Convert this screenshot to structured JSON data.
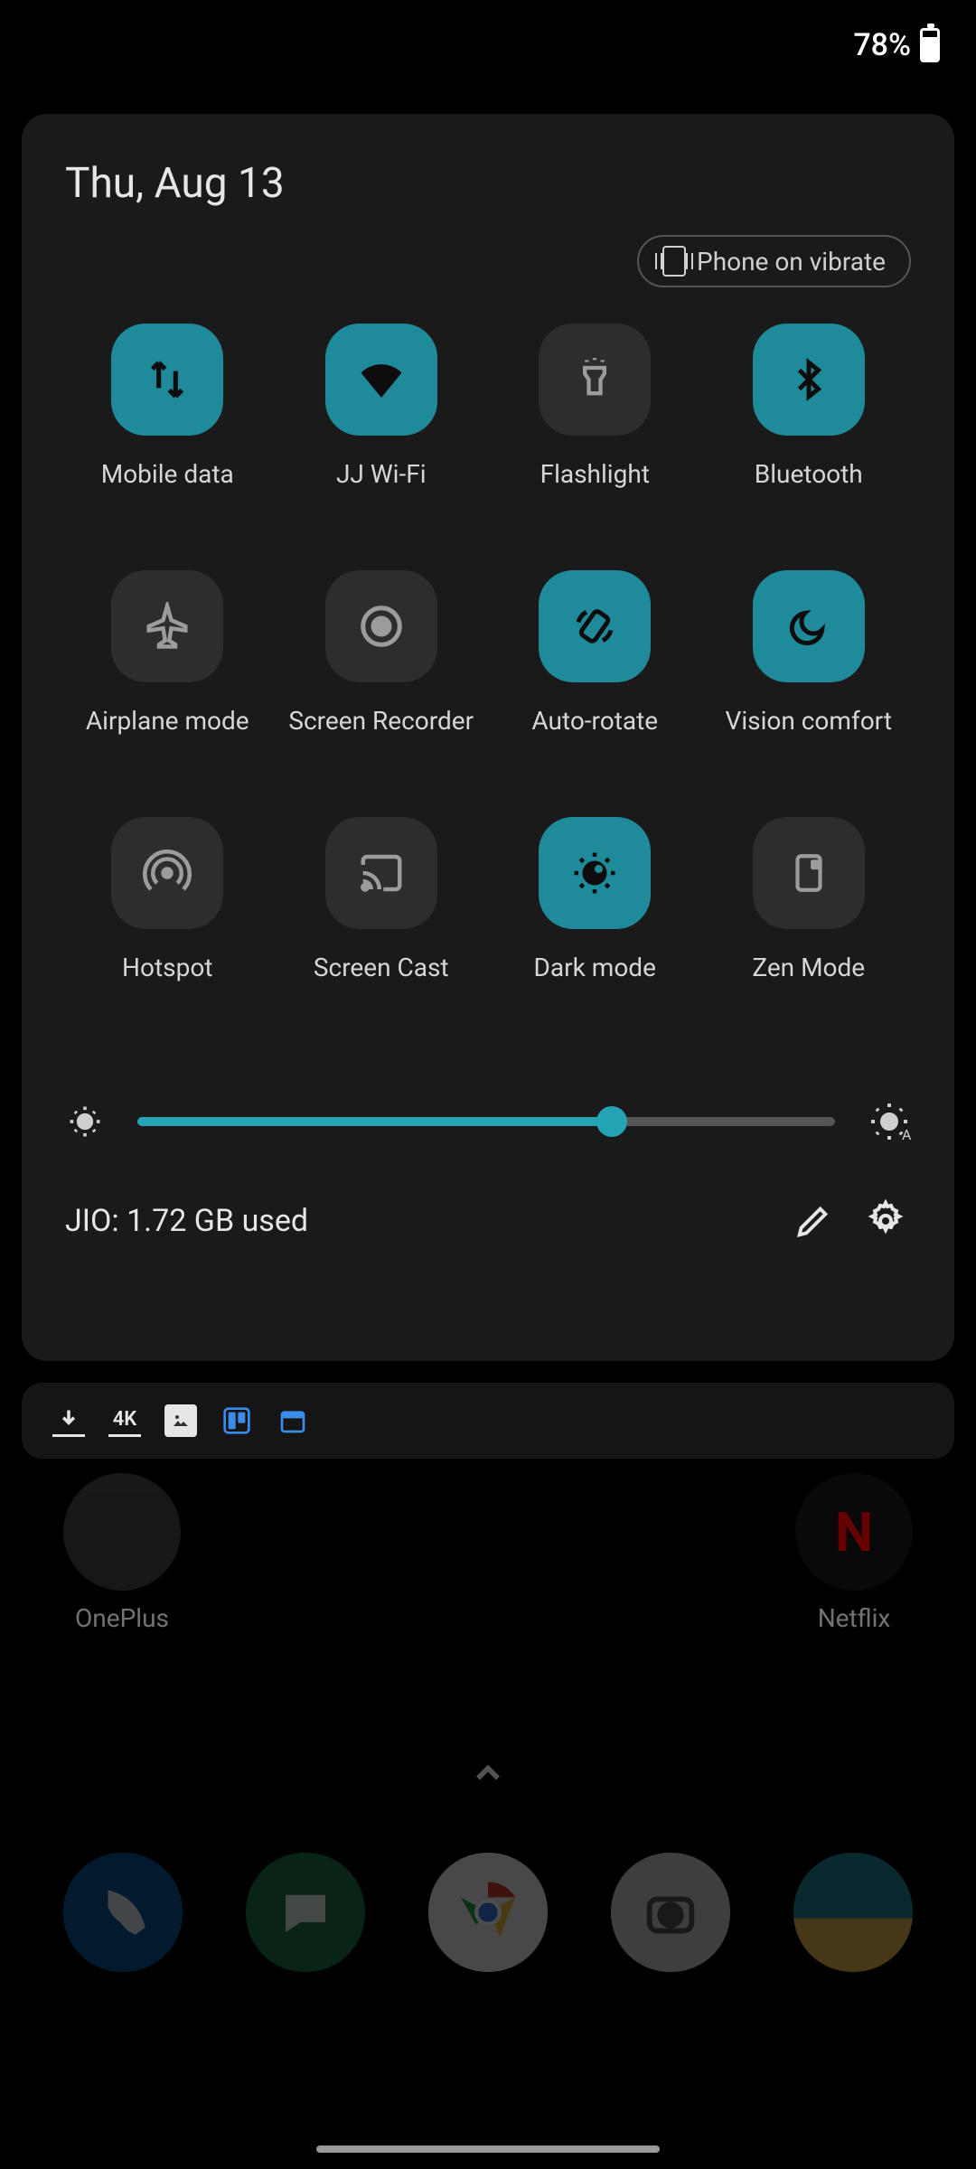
{
  "status": {
    "battery_percent_label": "78%",
    "battery_percent_value": 78
  },
  "panel": {
    "date": "Thu, Aug 13",
    "ringer_chip": "Phone on vibrate",
    "tiles": [
      {
        "id": "mobile-data",
        "label": "Mobile data",
        "active": true
      },
      {
        "id": "wifi",
        "label": "JJ Wi-Fi",
        "active": true
      },
      {
        "id": "flashlight",
        "label": "Flashlight",
        "active": false
      },
      {
        "id": "bluetooth",
        "label": "Bluetooth",
        "active": true
      },
      {
        "id": "airplane-mode",
        "label": "Airplane mode",
        "active": false
      },
      {
        "id": "screen-recorder",
        "label": "Screen Recorder",
        "active": false
      },
      {
        "id": "auto-rotate",
        "label": "Auto-rotate",
        "active": true
      },
      {
        "id": "vision-comfort",
        "label": "Vision comfort",
        "active": true
      },
      {
        "id": "hotspot",
        "label": "Hotspot",
        "active": false
      },
      {
        "id": "screen-cast",
        "label": "Screen Cast",
        "active": false
      },
      {
        "id": "dark-mode",
        "label": "Dark mode",
        "active": true
      },
      {
        "id": "zen-mode",
        "label": "Zen Mode",
        "active": false
      }
    ],
    "brightness_percent": 68,
    "auto_brightness": true,
    "data_usage": "JIO: 1.72 GB used"
  },
  "notification_icons": [
    "download-icon",
    "4k-icon",
    "gallery-icon",
    "trello-icon",
    "calendar-icon"
  ],
  "home": {
    "folder_label": "OnePlus",
    "netflix_label": "Netflix"
  },
  "colors": {
    "accent": "#1f8a99",
    "tile_off": "#2d2d2d",
    "panel_bg": "#1a1a1a"
  }
}
